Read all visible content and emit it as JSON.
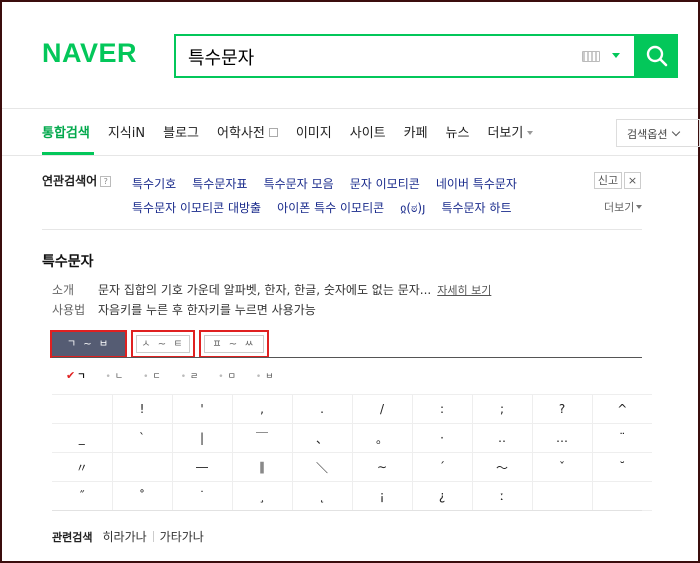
{
  "header": {
    "logo": "NAVER",
    "search_value": "특수문자"
  },
  "colors": {
    "brand_green": "#03c75a",
    "link_blue": "#1a2b8c",
    "highlight_red": "#e02020"
  },
  "tabs": [
    {
      "label": "통합검색",
      "active": true
    },
    {
      "label": "지식iN"
    },
    {
      "label": "블로그"
    },
    {
      "label": "어학사전"
    },
    {
      "label": "이미지"
    },
    {
      "label": "사이트"
    },
    {
      "label": "카페"
    },
    {
      "label": "뉴스"
    },
    {
      "label": "더보기"
    }
  ],
  "options_label": "검색옵션",
  "related": {
    "title": "연관검색어",
    "help": "?",
    "report": "신고",
    "close": "×",
    "more": "더보기",
    "links": [
      "특수기호",
      "특수문자표",
      "특수문자 모음",
      "문자 이모티콘",
      "네이버 특수문자",
      "특수문자 이모티콘 대방출",
      "아이폰 특수 이모티콘",
      "ჲ(ಠ)յ",
      "특수문자 하트"
    ]
  },
  "section": {
    "title": "특수문자",
    "intro_label": "소개",
    "intro_text": "문자 집합의 기호 가운데 알파벳, 한자, 한글, 숫자에도 없는 문자...",
    "intro_more": "자세히 보기",
    "usage_label": "사용법",
    "usage_text": "자음키를 누른 후 한자키를 누르면 사용가능"
  },
  "category_tabs": [
    "ㄱ ~ ㅂ",
    "ㅅ ~ ㅌ",
    "ㅍ ~ ㅆ"
  ],
  "jamo": [
    "ㄱ",
    "ㄴ",
    "ㄷ",
    "ㄹ",
    "ㅁ",
    "ㅂ"
  ],
  "grid": [
    [
      "",
      "!",
      "'",
      ",",
      ".",
      "/",
      ":",
      ";",
      "?",
      "^"
    ],
    [
      "_",
      "`",
      "|",
      "￣",
      "、",
      "。",
      "·",
      "‥",
      "…",
      "¨"
    ],
    [
      "〃",
      "",
      "―",
      "∥",
      "＼",
      "∼",
      "´",
      "～",
      "ˇ",
      "˘"
    ],
    [
      "˝",
      "˚",
      "˙",
      "¸",
      "˛",
      "¡",
      "¿",
      "ː",
      "",
      ""
    ]
  ],
  "bottom_related": {
    "label": "관련검색",
    "links": [
      "히라가나",
      "가타가나"
    ]
  }
}
